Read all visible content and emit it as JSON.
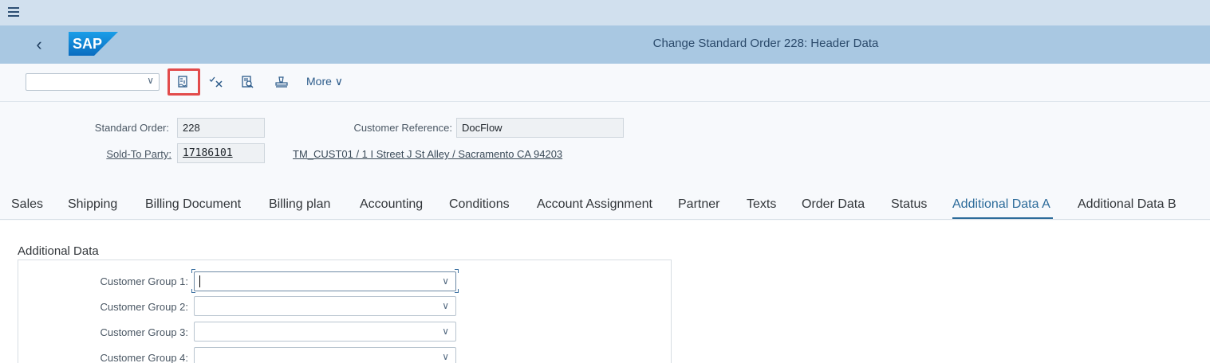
{
  "shell": {
    "title": "Change Standard Order 228: Header Data",
    "logo_text": "SAP",
    "back_glyph": "‹",
    "menu_icon": "hamburger-icon"
  },
  "toolbar": {
    "select_value": "",
    "more_label": "More",
    "more_chevron": "∨",
    "icons": [
      "display-document-icon",
      "cancel-check-icon",
      "document-search-icon",
      "print-icon"
    ],
    "highlight_color": "#e24b4b"
  },
  "header": {
    "standard_order_label": "Standard Order:",
    "standard_order_value": "228",
    "sold_to_label": "Sold-To Party:",
    "sold_to_value": "17186101",
    "customer_reference_label": "Customer Reference:",
    "customer_reference_value": "DocFlow",
    "address_link": "TM_CUST01 / 1 I Street J St Alley / Sacramento CA 94203"
  },
  "tabs": [
    {
      "label": "Sales"
    },
    {
      "label": "Shipping"
    },
    {
      "label": "Billing Document"
    },
    {
      "label": "Billing plan"
    },
    {
      "label": "Accounting"
    },
    {
      "label": "Conditions"
    },
    {
      "label": "Account Assignment"
    },
    {
      "label": "Partner"
    },
    {
      "label": "Texts"
    },
    {
      "label": "Order Data"
    },
    {
      "label": "Status"
    },
    {
      "label": "Additional Data A"
    },
    {
      "label": "Additional Data B"
    }
  ],
  "active_tab": "Additional Data A",
  "additional_data": {
    "title": "Additional Data",
    "fields": [
      {
        "label": "Customer Group 1:",
        "value": ""
      },
      {
        "label": "Customer Group 2:",
        "value": ""
      },
      {
        "label": "Customer Group 3:",
        "value": ""
      },
      {
        "label": "Customer Group 4:",
        "value": ""
      }
    ]
  },
  "colors": {
    "menubar": "#d1e0ee",
    "shellbar": "#a9c8e2",
    "accent": "#2c6b9a"
  }
}
